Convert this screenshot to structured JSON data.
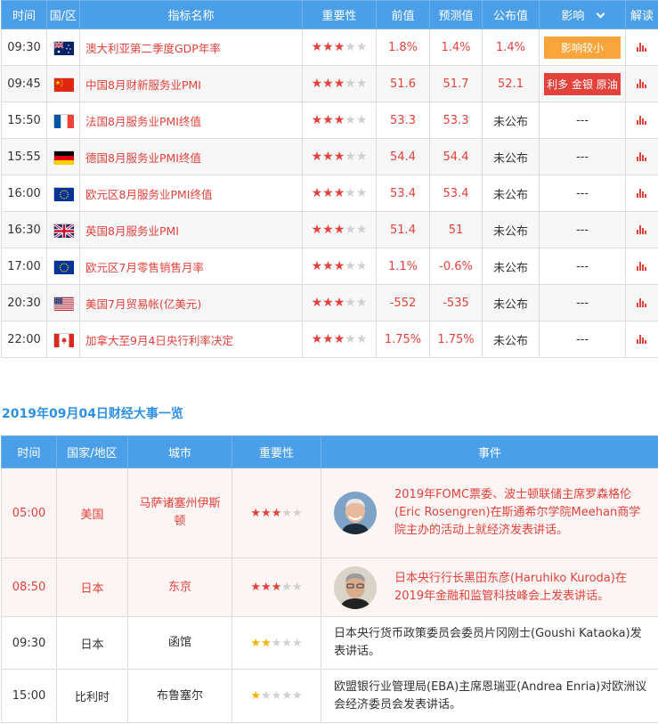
{
  "calendar": {
    "headers": [
      "时间",
      "国/区",
      "指标名称",
      "重要性",
      "前值",
      "预测值",
      "公布值",
      "影响",
      "解读"
    ],
    "rows": [
      {
        "time": "09:30",
        "flag": "australia-flag-icon",
        "name": "澳大利亚第二季度GDP年率",
        "stars": 3,
        "prev": "1.8%",
        "forecast": "1.4%",
        "actual": "1.4%",
        "impact": "影响较小",
        "impact_type": "orange"
      },
      {
        "time": "09:45",
        "flag": "china-flag-icon",
        "name": "中国8月财新服务业PMI",
        "stars": 3,
        "prev": "51.6",
        "forecast": "51.7",
        "actual": "52.1",
        "impact": "利多 金银 原油",
        "impact_type": "red"
      },
      {
        "time": "15:50",
        "flag": "france-flag-icon",
        "name": "法国8月服务业PMI终值",
        "stars": 3,
        "prev": "53.3",
        "forecast": "53.3",
        "actual": "未公布",
        "impact": "---",
        "impact_type": "none"
      },
      {
        "time": "15:55",
        "flag": "germany-flag-icon",
        "name": "德国8月服务业PMI终值",
        "stars": 3,
        "prev": "54.4",
        "forecast": "54.4",
        "actual": "未公布",
        "impact": "---",
        "impact_type": "none"
      },
      {
        "time": "16:00",
        "flag": "eu-flag-icon",
        "name": "欧元区8月服务业PMI终值",
        "stars": 3,
        "prev": "53.4",
        "forecast": "53.4",
        "actual": "未公布",
        "impact": "---",
        "impact_type": "none"
      },
      {
        "time": "16:30",
        "flag": "uk-flag-icon",
        "name": "英国8月服务业PMI",
        "stars": 3,
        "prev": "51.4",
        "forecast": "51",
        "actual": "未公布",
        "impact": "---",
        "impact_type": "none"
      },
      {
        "time": "17:00",
        "flag": "eu-flag-icon",
        "name": "欧元区7月零售销售月率",
        "stars": 3,
        "prev": "1.1%",
        "forecast": "-0.6%",
        "actual": "未公布",
        "impact": "---",
        "impact_type": "none"
      },
      {
        "time": "20:30",
        "flag": "usa-flag-icon",
        "name": "美国7月贸易帐(亿美元)",
        "stars": 3,
        "prev": "-552",
        "forecast": "-535",
        "actual": "未公布",
        "impact": "---",
        "impact_type": "none"
      },
      {
        "time": "22:00",
        "flag": "canada-flag-icon",
        "name": "加拿大至9月4日央行利率决定",
        "stars": 3,
        "prev": "1.75%",
        "forecast": "1.75%",
        "actual": "未公布",
        "impact": "---",
        "impact_type": "none"
      }
    ]
  },
  "events": {
    "title": "2019年09月04日财经大事一览",
    "headers": [
      "时间",
      "国家/地区",
      "城市",
      "重要性",
      "事件"
    ],
    "rows": [
      {
        "time": "05:00",
        "country": "美国",
        "city": "马萨诸塞州伊斯顿",
        "stars": 3,
        "highlight": true,
        "avatar": "rosengren-avatar",
        "event": "2019年FOMC票委、波士顿联储主席罗森格伦(Eric Rosengren)在斯通希尔学院Meehan商学院主办的活动上就经济发表讲话。"
      },
      {
        "time": "08:50",
        "country": "日本",
        "city": "东京",
        "stars": 3,
        "highlight": true,
        "avatar": "kuroda-avatar",
        "event": "日本央行行长黑田东彦(Haruhiko Kuroda)在2019年金融和监管科技峰会上发表讲话。"
      },
      {
        "time": "09:30",
        "country": "日本",
        "city": "函馆",
        "stars": 2,
        "highlight": false,
        "avatar": null,
        "event": "日本央行货币政策委员会委员片冈刚士(Goushi Kataoka)发表讲话。"
      },
      {
        "time": "15:00",
        "country": "比利时",
        "city": "布鲁塞尔",
        "stars": 1,
        "highlight": false,
        "avatar": null,
        "event": "欧盟银行业管理局(EBA)主席恩瑞亚(Andrea Enria)对欧洲议会经济委员会发表讲话。"
      }
    ]
  },
  "colors": {
    "header": "#4a9fe8",
    "red": "#e2423b",
    "orange": "#f9a53b",
    "title": "#2f8fe0",
    "star_yellow": "#f0b400"
  }
}
